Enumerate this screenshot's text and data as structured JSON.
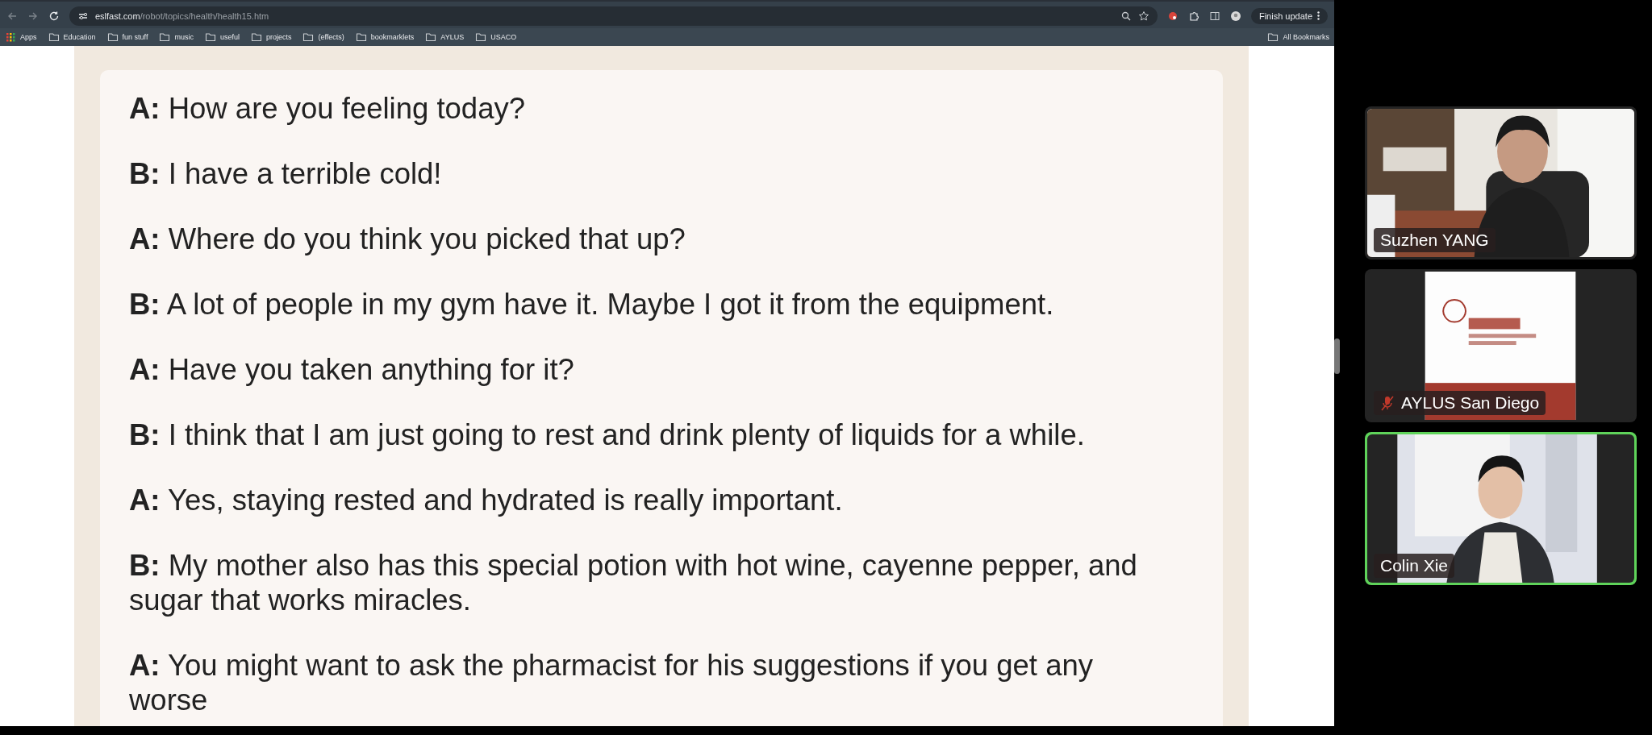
{
  "browser": {
    "url_host": "eslfast.com",
    "url_path": "/robot/topics/health/health15.htm",
    "update_button": "Finish update",
    "bookmarks": [
      {
        "kind": "apps",
        "label": "Apps"
      },
      {
        "kind": "folder",
        "label": "Education"
      },
      {
        "kind": "folder",
        "label": "fun stuff"
      },
      {
        "kind": "folder",
        "label": "music"
      },
      {
        "kind": "folder",
        "label": "useful"
      },
      {
        "kind": "folder",
        "label": "projects"
      },
      {
        "kind": "folder",
        "label": "(effects)"
      },
      {
        "kind": "folder",
        "label": "bookmarklets"
      },
      {
        "kind": "folder",
        "label": "AYLUS"
      },
      {
        "kind": "folder",
        "label": "USACO"
      }
    ],
    "all_bookmarks": "All Bookmarks"
  },
  "dialogue": [
    {
      "speaker": "A:",
      "text": "How are you feeling today?"
    },
    {
      "speaker": "B:",
      "text": "I have a terrible cold!"
    },
    {
      "speaker": "A:",
      "text": "Where do you think you picked that up?"
    },
    {
      "speaker": "B:",
      "text": "A lot of people in my gym have it. Maybe I got it from the equipment."
    },
    {
      "speaker": "A:",
      "text": "Have you taken anything for it?"
    },
    {
      "speaker": "B:",
      "text": "I think that I am just going to rest and drink plenty of liquids for a while."
    },
    {
      "speaker": "A:",
      "text": "Yes, staying rested and hydrated is really important."
    },
    {
      "speaker": "B:",
      "text": "My mother also has this special potion with hot wine, cayenne pepper, and sugar that works miracles."
    },
    {
      "speaker": "A:",
      "text": "You might want to ask the pharmacist for his suggestions if you get any worse"
    }
  ],
  "participants": [
    {
      "name": "Suzhen YANG",
      "kind": "room",
      "muted": false,
      "active_speaker": false
    },
    {
      "name": "AYLUS San Diego",
      "kind": "slide",
      "muted": true,
      "active_speaker": false
    },
    {
      "name": "Colin Xie",
      "kind": "door",
      "muted": false,
      "active_speaker": true
    }
  ]
}
